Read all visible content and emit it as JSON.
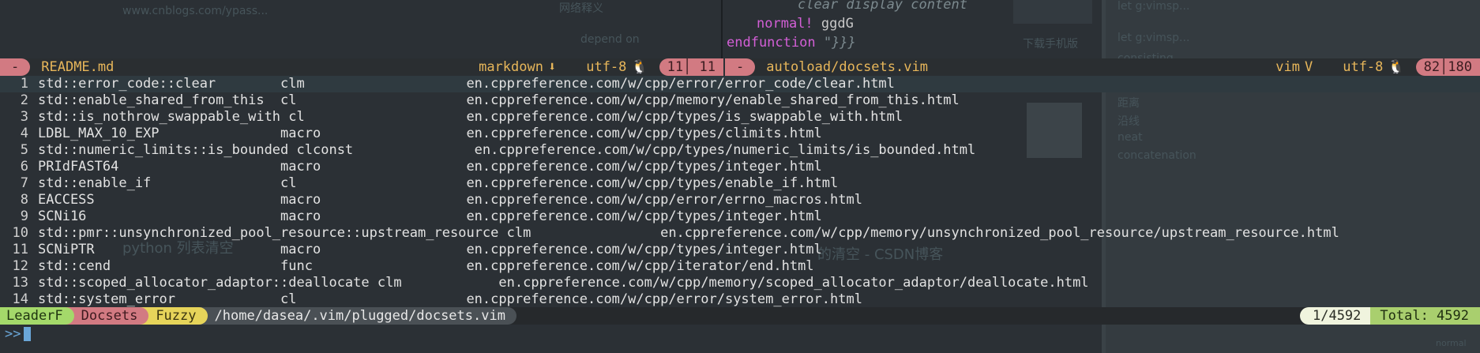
{
  "top_editor": {
    "line1": "clear display content",
    "line2_kw": "normal!",
    "line2_rest": " ggdG",
    "line3_kw": "endfunction",
    "line3_rest": " \"}}}"
  },
  "left_status": {
    "mode": "-",
    "file": "README.md",
    "filetype": "markdown",
    "filetype_icon": "⬇",
    "encoding": "utf-8",
    "os_icon": "🐧",
    "position": "11│ 11"
  },
  "right_status": {
    "mode": "-",
    "file": "autoload/docsets.vim",
    "filetype": "vim",
    "filetype_icon": "V",
    "encoding": "utf-8",
    "os_icon": "🐧",
    "position": "82│180"
  },
  "results": [
    {
      "n": "1",
      "text": "std::error_code::clear        clm                    en.cppreference.com/w/cpp/error/error_code/clear.html"
    },
    {
      "n": "2",
      "text": "std::enable_shared_from_this  cl                     en.cppreference.com/w/cpp/memory/enable_shared_from_this.html"
    },
    {
      "n": "3",
      "text": "std::is_nothrow_swappable_with cl                    en.cppreference.com/w/cpp/types/is_swappable_with.html"
    },
    {
      "n": "4",
      "text": "LDBL_MAX_10_EXP               macro                  en.cppreference.com/w/cpp/types/climits.html"
    },
    {
      "n": "5",
      "text": "std::numeric_limits::is_bounded clconst               en.cppreference.com/w/cpp/types/numeric_limits/is_bounded.html"
    },
    {
      "n": "6",
      "text": "PRIdFAST64                    macro                  en.cppreference.com/w/cpp/types/integer.html"
    },
    {
      "n": "7",
      "text": "std::enable_if                cl                     en.cppreference.com/w/cpp/types/enable_if.html"
    },
    {
      "n": "8",
      "text": "EACCESS                       macro                  en.cppreference.com/w/cpp/error/errno_macros.html"
    },
    {
      "n": "9",
      "text": "SCNi16                        macro                  en.cppreference.com/w/cpp/types/integer.html"
    },
    {
      "n": "10",
      "text": "std::pmr::unsynchronized_pool_resource::upstream_resource clm                en.cppreference.com/w/cpp/memory/unsynchronized_pool_resource/upstream_resource.html"
    },
    {
      "n": "11",
      "text": "SCNiPTR                       macro                  en.cppreference.com/w/cpp/types/integer.html"
    },
    {
      "n": "12",
      "text": "std::cend                     func                   en.cppreference.com/w/cpp/iterator/end.html"
    },
    {
      "n": "13",
      "text": "std::scoped_allocator_adaptor::deallocate clm            en.cppreference.com/w/cpp/memory/scoped_allocator_adaptor/deallocate.html"
    },
    {
      "n": "14",
      "text": "std::system_error             cl                     en.cppreference.com/w/cpp/error/system_error.html"
    }
  ],
  "leaderf": {
    "name": "LeaderF",
    "category": "Docsets",
    "mode": "Fuzzy",
    "cwd": "/home/dasea/.vim/plugged/docsets.vim",
    "count": "1/4592",
    "total": "Total: 4592"
  },
  "prompt": {
    "symbol": ">>"
  },
  "background": {
    "snippets": [
      {
        "id": "bg1",
        "text": "www.cnblogs.com/ypass..."
      },
      {
        "id": "bg2",
        "text": "网络释义"
      },
      {
        "id": "bg3",
        "text": "depend on"
      },
      {
        "id": "bg4",
        "text": "下载手机版"
      },
      {
        "id": "bg5",
        "text": "let g:vimsp..."
      },
      {
        "id": "bg6",
        "text": "let g:vimsp..."
      },
      {
        "id": "bg7",
        "text": "consisting"
      },
      {
        "id": "bg8",
        "text": "距离"
      },
      {
        "id": "bg9",
        "text": "沿线"
      },
      {
        "id": "bg10",
        "text": "neat"
      },
      {
        "id": "bg11",
        "text": "concatenation"
      },
      {
        "id": "bg12",
        "text": "python 列表清空"
      },
      {
        "id": "bg13",
        "text": "的清空 - CSDN博客"
      },
      {
        "id": "bg14",
        "text": "normal"
      }
    ]
  }
}
